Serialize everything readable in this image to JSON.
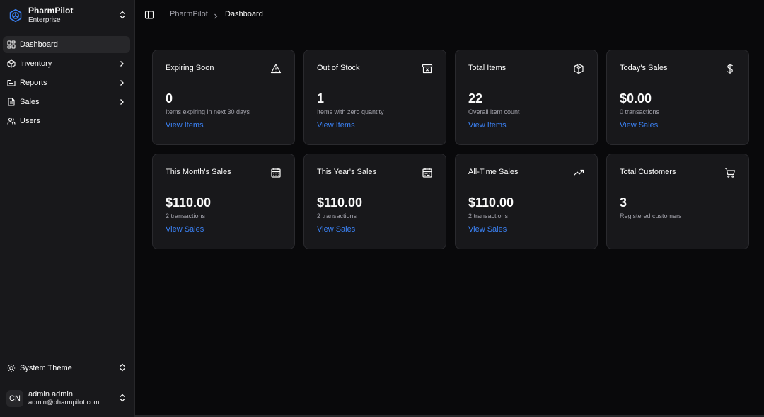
{
  "brand": {
    "name": "PharmPilot",
    "plan": "Enterprise"
  },
  "nav": {
    "items": [
      {
        "label": "Dashboard",
        "icon": "dashboard-icon",
        "active": true
      },
      {
        "label": "Inventory",
        "icon": "package-icon",
        "expandable": true
      },
      {
        "label": "Reports",
        "icon": "folder-icon",
        "expandable": true
      },
      {
        "label": "Sales",
        "icon": "receipt-icon",
        "expandable": true
      },
      {
        "label": "Users",
        "icon": "users-icon"
      }
    ]
  },
  "theme": {
    "label": "System Theme",
    "icon": "sun-icon"
  },
  "user": {
    "initials": "CN",
    "name": "admin admin",
    "email": "admin@pharmpilot.com"
  },
  "breadcrumb": {
    "root": "PharmPilot",
    "current": "Dashboard"
  },
  "colors": {
    "link": "#3b82f6",
    "background": "#09090b",
    "card": "#18181b"
  },
  "cards": [
    {
      "title": "Expiring Soon",
      "icon": "alert-triangle-icon",
      "value": "0",
      "sub": "Items expiring in next 30 days",
      "link": "View Items"
    },
    {
      "title": "Out of Stock",
      "icon": "archive-x-icon",
      "value": "1",
      "sub": "Items with zero quantity",
      "link": "View Items"
    },
    {
      "title": "Total Items",
      "icon": "box-icon",
      "value": "22",
      "sub": "Overall item count",
      "link": "View Items"
    },
    {
      "title": "Today's Sales",
      "icon": "dollar-icon",
      "value": "$0.00",
      "sub": "0 transactions",
      "link": "View Sales"
    },
    {
      "title": "This Month's Sales",
      "icon": "calendar-icon",
      "value": "$110.00",
      "sub": "2 transactions",
      "link": "View Sales"
    },
    {
      "title": "This Year's Sales",
      "icon": "calendar-range-icon",
      "value": "$110.00",
      "sub": "2 transactions",
      "link": "View Sales"
    },
    {
      "title": "All-Time Sales",
      "icon": "trending-up-icon",
      "value": "$110.00",
      "sub": "2 transactions",
      "link": "View Sales"
    },
    {
      "title": "Total Customers",
      "icon": "shopping-cart-icon",
      "value": "3",
      "sub": "Registered customers",
      "link": ""
    }
  ]
}
